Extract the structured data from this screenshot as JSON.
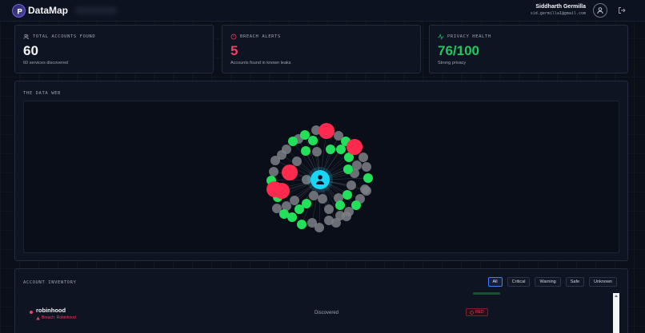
{
  "header": {
    "title": "DataMap",
    "user_name": "Siddharth Germilla",
    "user_email": "sid.germilla1@gmail.com"
  },
  "stats": [
    {
      "label": "TOTAL ACCOUNTS FOUND",
      "value": "60",
      "sub": "60 services discovered",
      "color": "#f3f4f6",
      "icon": "users-icon"
    },
    {
      "label": "BREACH ALERTS",
      "value": "5",
      "sub": "Accounts found in known leaks",
      "color": "#f43f5e",
      "icon": "alert-circle-icon"
    },
    {
      "label": "PRIVACY HEALTH",
      "value": "76/100",
      "sub": "Strong privacy",
      "color": "#22c55e",
      "icon": "activity-icon"
    }
  ],
  "web": {
    "title": "THE DATA WEB",
    "colors": {
      "safe": "#22e05a",
      "unknown": "#7d7f85",
      "critical": "#ff2a4d",
      "center": "#18d6f5"
    }
  },
  "inventory": {
    "title": "ACCOUNT INVENTORY",
    "filters": [
      "All",
      "Critical",
      "Warning",
      "Safe",
      "Unknown"
    ],
    "active_filter": "All",
    "row": {
      "name": "robinhood",
      "breach": "Breach: Robinhood",
      "status": "Discovered",
      "badge": "RED"
    }
  }
}
